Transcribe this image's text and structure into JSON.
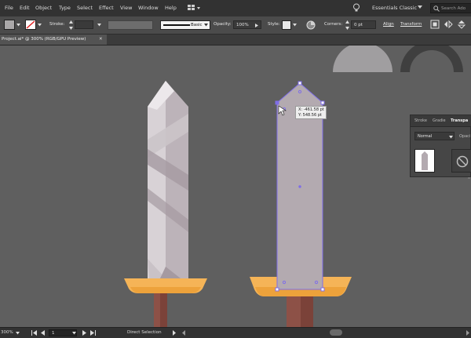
{
  "menu": {
    "items": [
      "File",
      "Edit",
      "Object",
      "Type",
      "Select",
      "Effect",
      "View",
      "Window",
      "Help"
    ],
    "workspace": "Essentials Classic",
    "search_placeholder": "Search Ado"
  },
  "control_bar": {
    "stroke_label": "Stroke:",
    "brush_label": "Basic",
    "opacity_label": "Opacity:",
    "opacity_value": "100%",
    "style_label": "Style:",
    "corners_label": "Corners:",
    "corners_value": "0 pt",
    "align_label": "Align",
    "transform_label": "Transform"
  },
  "document_tab": {
    "title": "Project.ai* @ 300% (RGB/GPU Preview)",
    "close_glyph": "✕"
  },
  "canvas": {
    "tooltip": {
      "x_text": "X: -461.58 pt",
      "y_text": "Y: 548.56 pt"
    }
  },
  "panel": {
    "tabs": [
      "Stroke",
      "Gradie",
      "Transpa"
    ],
    "blend_mode": "Normal",
    "opacity_label": "Opaci"
  },
  "status_bar": {
    "zoom": "300%",
    "artboard": "1",
    "tool": "Direct Selection"
  },
  "colors": {
    "canvas": "#5f5f5f",
    "blade_left": "#d8d2d6",
    "blade_right": "#bcb3b9",
    "shape_fill": "#b3aab0",
    "guard": "#f5b457",
    "handle": "#8d5147",
    "selection": "#7f6ee8"
  }
}
